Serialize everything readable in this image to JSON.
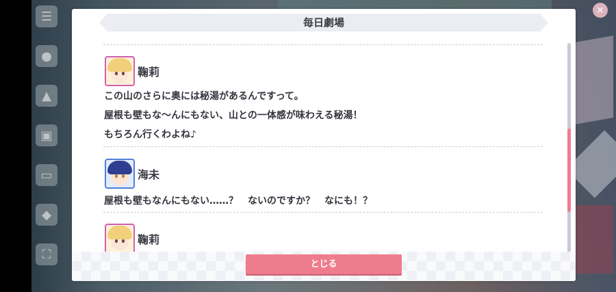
{
  "dialog": {
    "title": "毎日劇場",
    "close_label": "とじる"
  },
  "entries": [
    {
      "speaker": "鞠莉",
      "avatar": "mari-avatar",
      "lines": [
        "この山のさらに奥には秘湯があるんですって。",
        "屋根も壁もな〜んにもない、山との一体感が味わえる秘湯！",
        "もちろん行くわよね♪"
      ]
    },
    {
      "speaker": "海未",
      "avatar": "umi-avatar",
      "lines": [
        "屋根も壁もなんにもない……？　ないのですか？　なにも！？"
      ]
    },
    {
      "speaker": "鞠莉",
      "avatar": "mari-avatar",
      "lines": []
    }
  ],
  "side_menu": {
    "icons": [
      "menu-icon",
      "chat-icon",
      "costume-icon",
      "present-icon",
      "screen-icon",
      "trophy-icon",
      "fullscreen-icon"
    ]
  },
  "colors": {
    "accent": "#ef7c8c",
    "title_bar": "#ecedf2",
    "text": "#33343d"
  }
}
